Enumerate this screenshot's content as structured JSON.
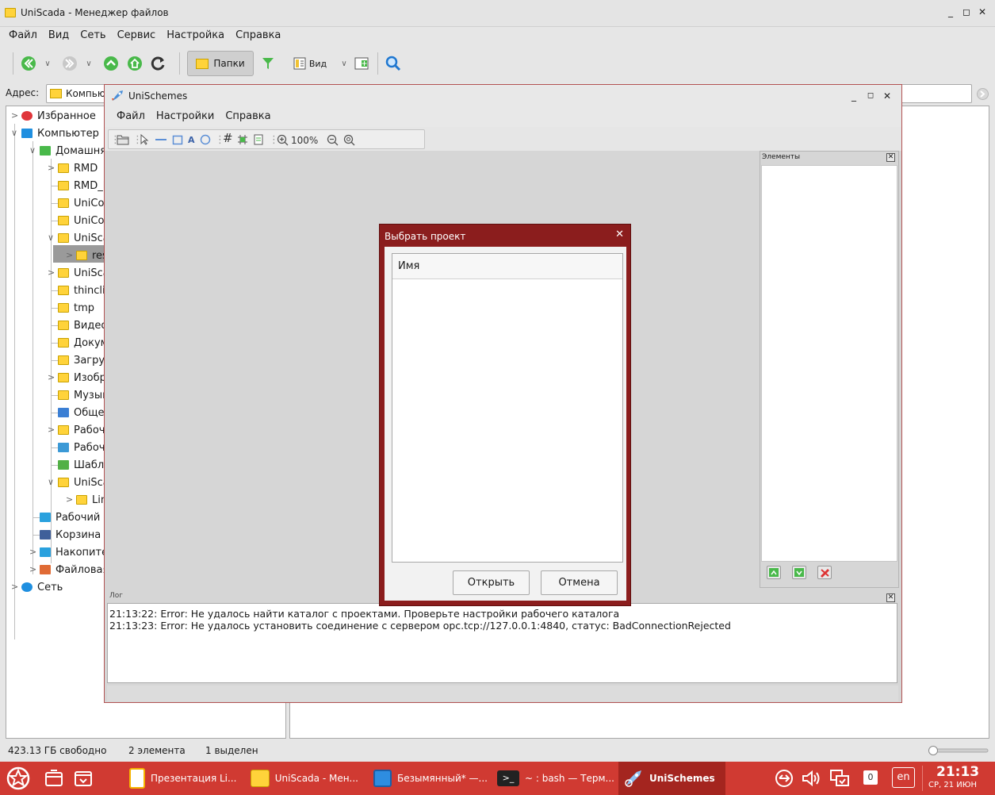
{
  "file_manager": {
    "title": "UniScada - Менеджер файлов",
    "menu": [
      "Файл",
      "Вид",
      "Сеть",
      "Сервис",
      "Настройка",
      "Справка"
    ],
    "toolbar": {
      "folders_label": "Папки",
      "view_label": "Вид"
    },
    "address_label": "Адрес:",
    "address_value": "Компьютер",
    "tree": [
      {
        "label": "Избранное"
      },
      {
        "label": "Компьютер"
      },
      {
        "label": "Домашняя"
      },
      {
        "label": "RMD"
      },
      {
        "label": "RMD_i"
      },
      {
        "label": "UniCor"
      },
      {
        "label": "UniCor"
      },
      {
        "label": "UniSca"
      },
      {
        "label": "res"
      },
      {
        "label": "UniSca"
      },
      {
        "label": "thincli"
      },
      {
        "label": "tmp"
      },
      {
        "label": "Видео"
      },
      {
        "label": "Докум"
      },
      {
        "label": "Загруз"
      },
      {
        "label": "Изобр"
      },
      {
        "label": "Музык"
      },
      {
        "label": "Общед"
      },
      {
        "label": "Рабоч"
      },
      {
        "label": "Рабоч"
      },
      {
        "label": "Шабло"
      },
      {
        "label": "UniSca"
      },
      {
        "label": "Linu"
      },
      {
        "label": "Рабочий"
      },
      {
        "label": "Корзина"
      },
      {
        "label": "Накопите"
      },
      {
        "label": "Файловая"
      },
      {
        "label": "Сеть"
      }
    ],
    "status": {
      "free": "423.13 ГБ свободно",
      "count": "2 элемента",
      "selected": "1 выделен"
    }
  },
  "unischemes": {
    "title": "UniSchemes",
    "menu": [
      "Файл",
      "Настройки",
      "Справка"
    ],
    "toolbar": {
      "zoom": "100%"
    },
    "elements_title": "Элементы",
    "log_title": "Лог",
    "log_lines": [
      "21:13:22: Error: Не удалось найти каталог с проектами. Проверьте настройки рабочего каталога",
      "21:13:23: Error: Не удалось установить соединение с сервером opc.tcp://127.0.0.1:4840, статус: BadConnectionRejected"
    ]
  },
  "dialog": {
    "title": "Выбрать проект",
    "column_header": "Имя",
    "open_label": "Открыть",
    "cancel_label": "Отмена"
  },
  "taskbar": {
    "tasks": [
      {
        "label": "Презентация Li..."
      },
      {
        "label": "UniScada - Мен..."
      },
      {
        "label": "Безымянный* —..."
      },
      {
        "label": "~ : bash — Терм..."
      },
      {
        "label": "UniSchemes"
      }
    ],
    "notifications": "0",
    "language": "en",
    "time": "21:13",
    "date": "СР, 21 ИЮН"
  },
  "colors": {
    "taskbar": "#d03a32",
    "dialog_frame": "#8b1d1d",
    "folder": "#ffd33a"
  }
}
